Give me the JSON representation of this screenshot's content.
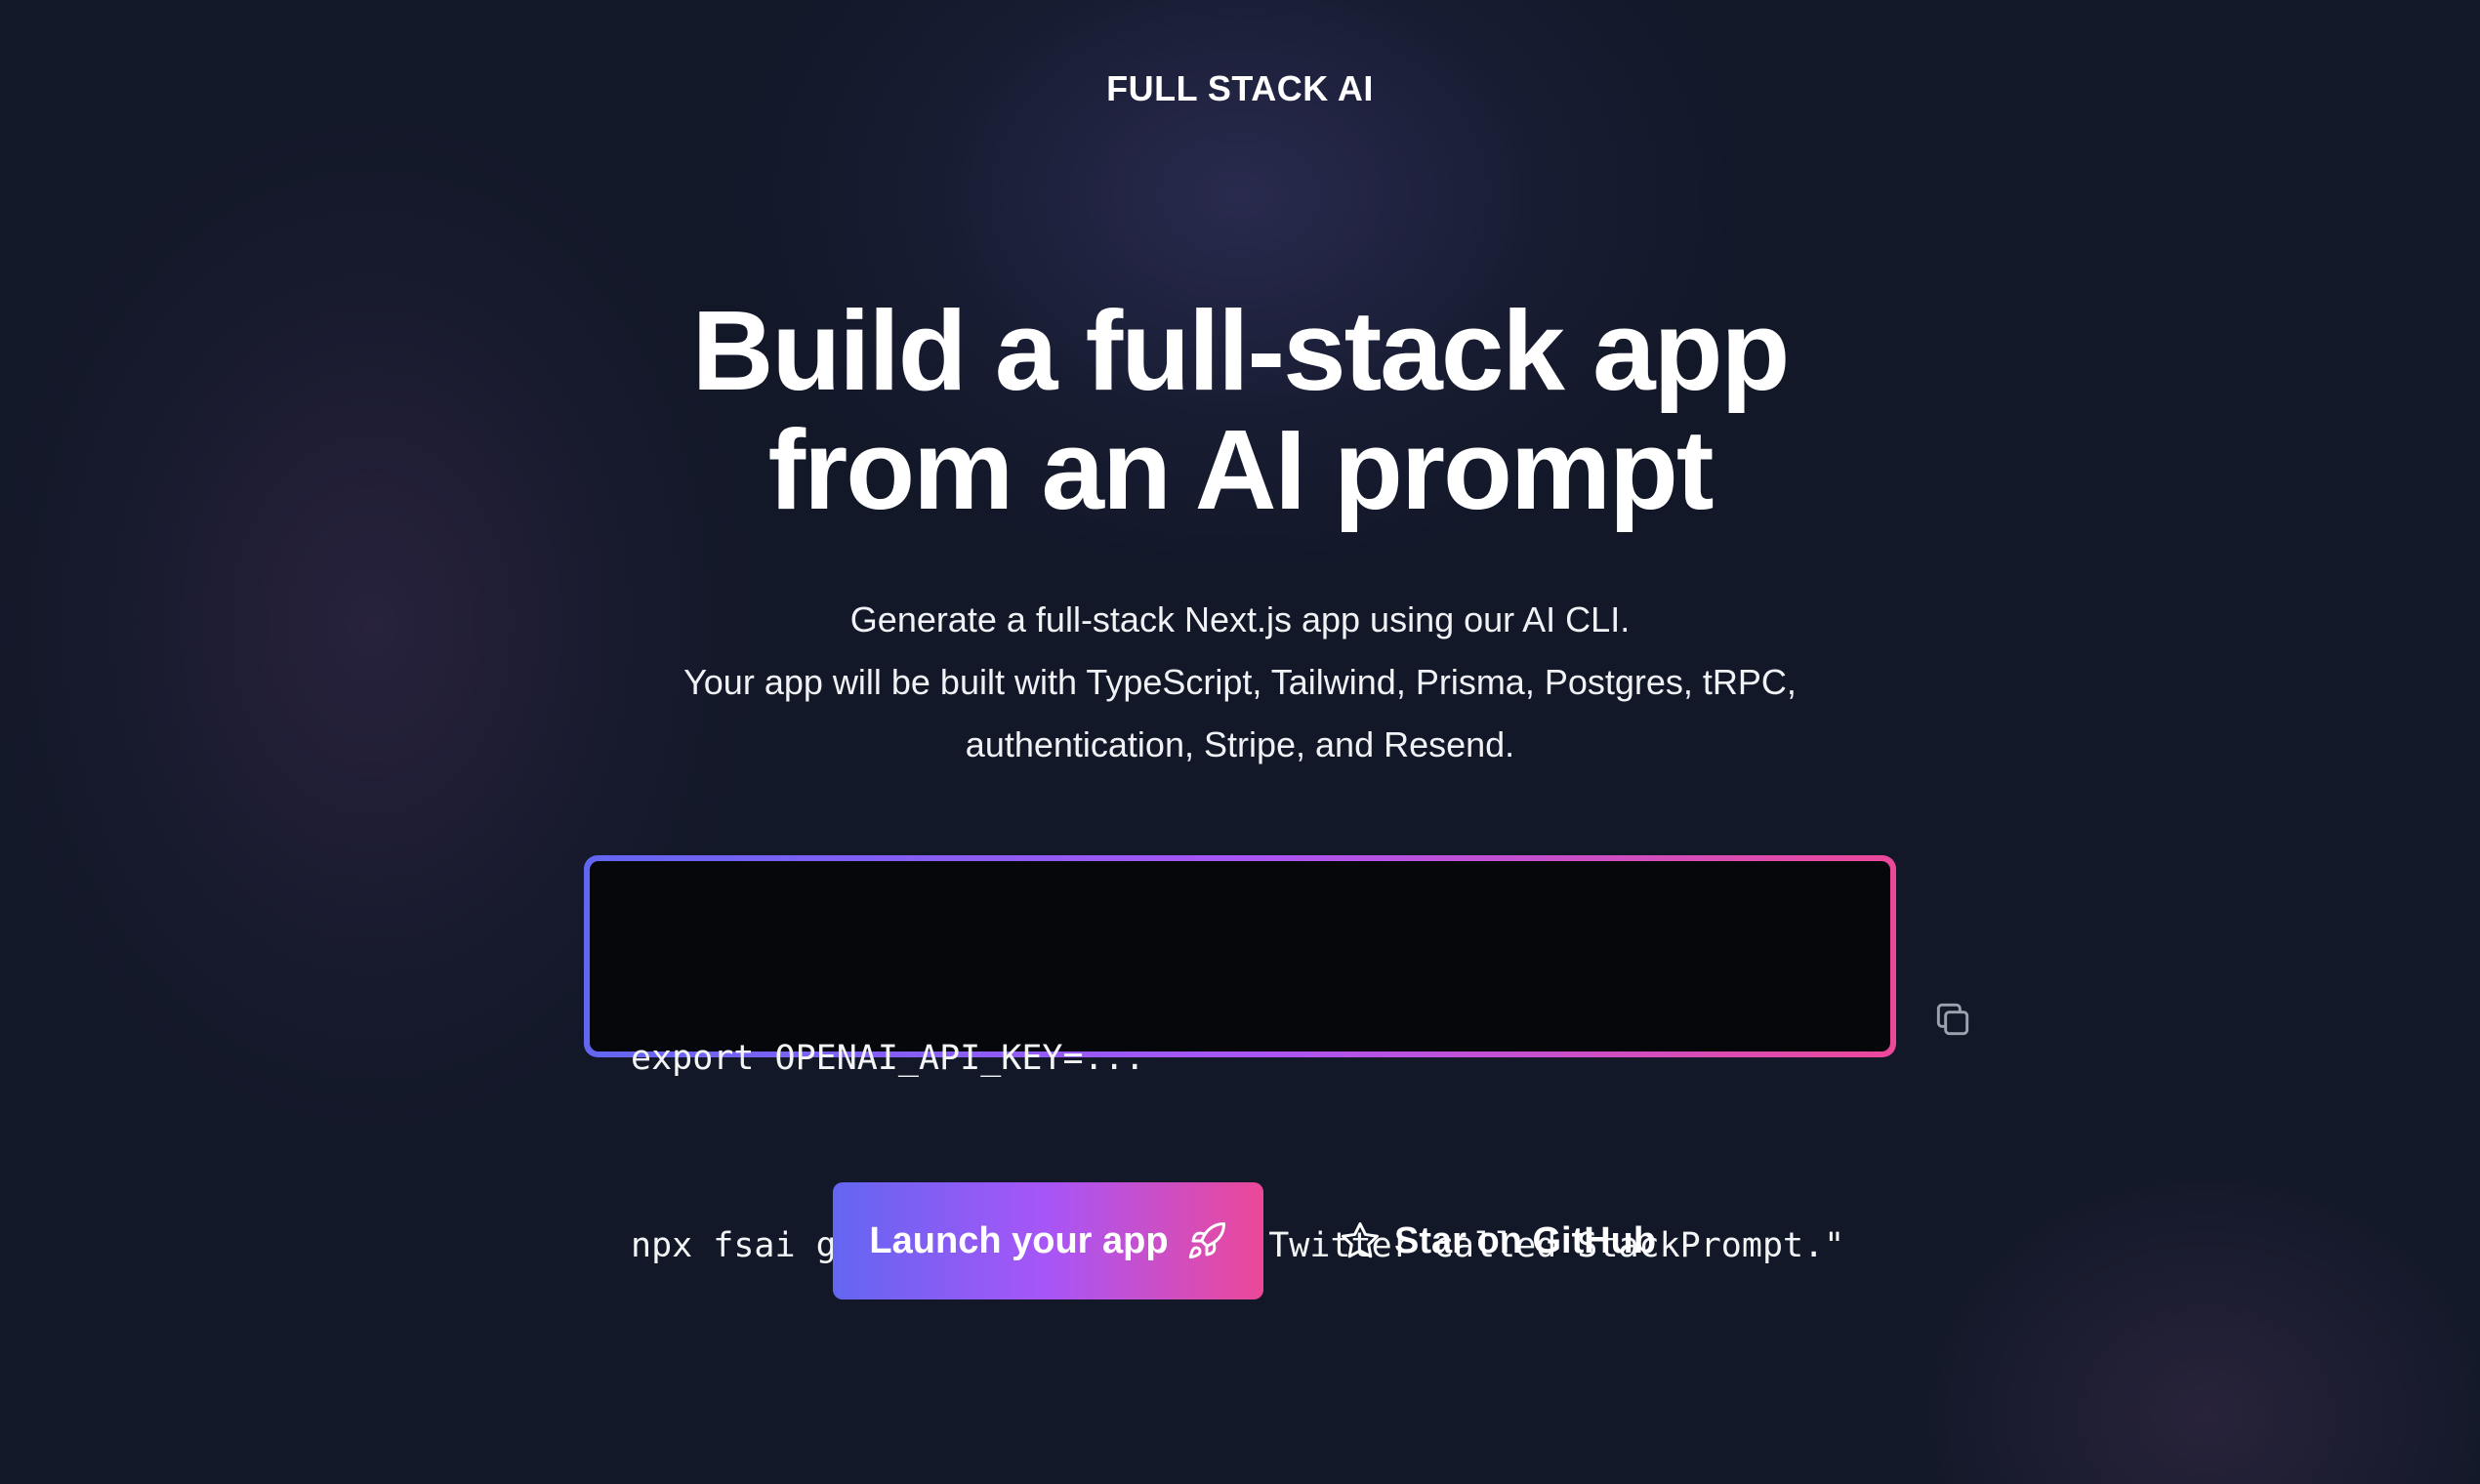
{
  "header": {
    "brand": "FULL STACK AI"
  },
  "hero": {
    "headline_line1": "Build a full-stack app",
    "headline_line2": "from an AI prompt",
    "subtext_line1": "Generate a full-stack Next.js app using our AI CLI.",
    "subtext_line2": "Your app will be built with TypeScript, Tailwind, Prisma, Postgres, tRPC,",
    "subtext_line3": "authentication, Stripe, and Resend."
  },
  "code": {
    "line1": "export OPENAI_API_KEY=...",
    "line2": "npx fsai gen \"Build a clone of Twitter called StackPrompt.\"",
    "copy_icon": "copy-icon"
  },
  "actions": {
    "launch_label": "Launch your app",
    "launch_icon": "rocket-icon",
    "github_label": "Star on GitHub",
    "github_icon": "star-icon"
  },
  "colors": {
    "background": "#121828",
    "gradient_start": "#6366f1",
    "gradient_mid": "#a855f7",
    "gradient_end": "#ec4899",
    "code_background": "#06070b"
  }
}
